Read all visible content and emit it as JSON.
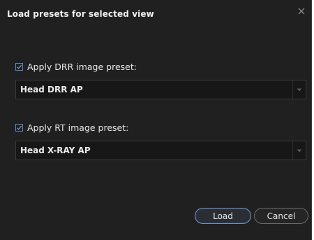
{
  "dialog": {
    "title": "Load presets for selected view",
    "drr": {
      "checkbox_label": "Apply DRR image preset:",
      "checked": true,
      "selected_value": "Head DRR AP"
    },
    "rt": {
      "checkbox_label": "Apply RT image preset:",
      "checked": true,
      "selected_value": "Head X-RAY AP"
    },
    "buttons": {
      "load_label": "Load",
      "cancel_label": "Cancel"
    },
    "icons": {
      "close": "close-icon",
      "check": "check-icon",
      "dropdown": "chevron-down-icon"
    },
    "colors": {
      "background": "#202020",
      "accent": "#5b87c6",
      "text": "#e8e8e8"
    }
  }
}
